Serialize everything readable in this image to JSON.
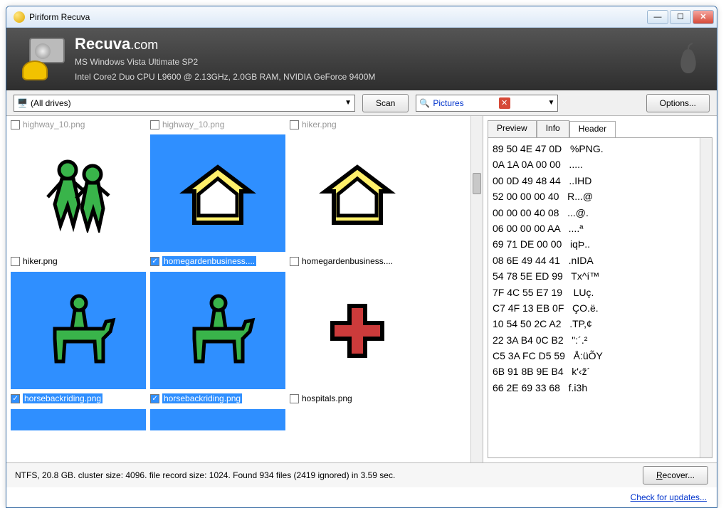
{
  "window": {
    "title": "Piriform Recuva"
  },
  "header": {
    "brand": "Recuva",
    "brand_suffix": ".com",
    "os": "MS Windows Vista Ultimate SP2",
    "hw": "Intel Core2 Duo CPU L9600 @ 2.13GHz, 2.0GB RAM, NVIDIA GeForce 9400M"
  },
  "toolbar": {
    "drives": "(All drives)",
    "scan": "Scan",
    "filter": "Pictures",
    "options": "Options..."
  },
  "partial_row": [
    "highway_10.png",
    "highway_10.png",
    "hiker.png"
  ],
  "files": {
    "row1": [
      {
        "name": "hiker.png",
        "selected": false,
        "checked": false,
        "icon": "hiker"
      },
      {
        "name": "homegardenbusiness....",
        "selected": true,
        "checked": true,
        "icon": "house-yellow"
      },
      {
        "name": "homegardenbusiness....",
        "selected": false,
        "checked": false,
        "icon": "house-yellow"
      }
    ],
    "row2": [
      {
        "name": "horsebackriding.png",
        "selected": true,
        "checked": true,
        "icon": "horse"
      },
      {
        "name": "horsebackriding.png",
        "selected": true,
        "checked": true,
        "icon": "horse"
      },
      {
        "name": "hospitals.png",
        "selected": false,
        "checked": false,
        "icon": "cross"
      }
    ]
  },
  "tabs": {
    "items": [
      "Preview",
      "Info",
      "Header"
    ],
    "active": 2
  },
  "hex_lines": [
    "89 50 4E 47 0D   %PNG.",
    "0A 1A 0A 00 00   .....",
    "00 0D 49 48 44   ..IHD",
    "52 00 00 00 40   R...@",
    "00 00 00 40 08   ...@.",
    "06 00 00 00 AA   ....ª",
    "69 71 DE 00 00   iqÞ..",
    "08 6E 49 44 41   .nIDA",
    "54 78 5E ED 99   Tx^í™",
    "7F 4C 55 E7 19    LUç.",
    "C7 4F 13 EB 0F   ÇO.ë.",
    "10 54 50 2C A2   .TP,¢",
    "22 3A B4 0C B2   \":´.²",
    "C5 3A FC D5 59   Å:üÕY",
    "6B 91 8B 9E B4   k'‹ž´",
    "66 2E 69 33 68   f.i3h"
  ],
  "status": {
    "text": "NTFS, 20.8 GB. cluster size: 4096. file record size: 1024. Found 934 files (2419 ignored) in 3.59 sec.",
    "recover": "Recover..."
  },
  "footer": {
    "update_link": "Check for updates..."
  }
}
